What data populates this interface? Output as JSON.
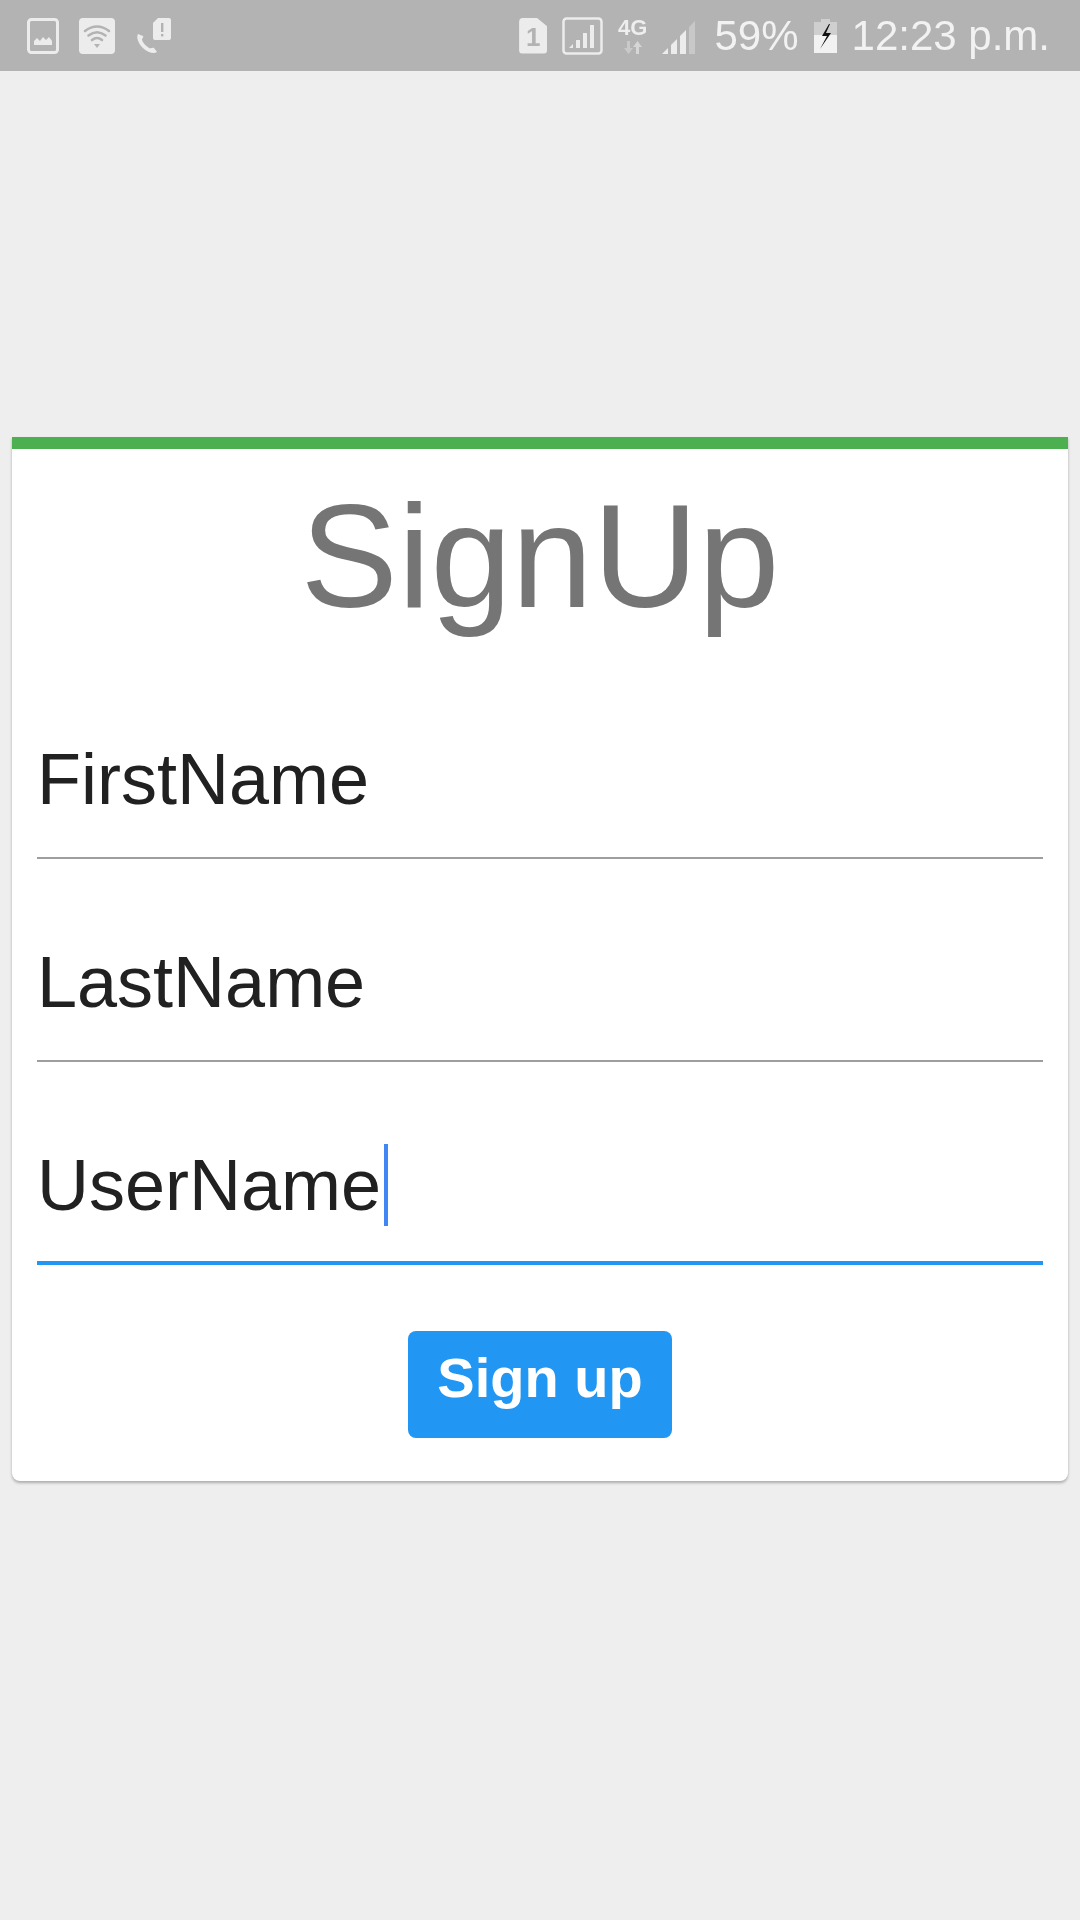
{
  "status_bar": {
    "sim_slot": "1",
    "network_type": "4G",
    "battery": "59%",
    "time": "12:23 p.m."
  },
  "form": {
    "title": "SignUp",
    "fields": [
      {
        "value": "FirstName",
        "focused": false
      },
      {
        "value": "LastName",
        "focused": false
      },
      {
        "value": "UserName",
        "focused": true
      }
    ],
    "submit": "Sign up"
  }
}
